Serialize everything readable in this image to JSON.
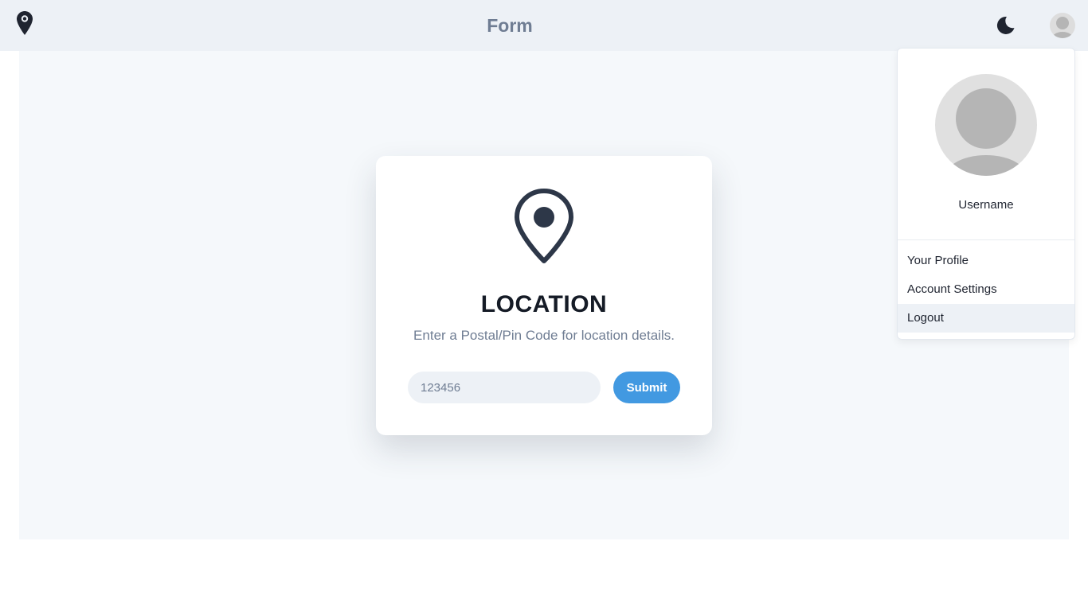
{
  "header": {
    "title": "Form",
    "logo_icon": "map-pin-icon",
    "theme_icon": "moon-icon",
    "avatar_icon": "user-avatar-icon"
  },
  "card": {
    "icon": "map-pin-icon",
    "title": "LOCATION",
    "subtitle": "Enter a Postal/Pin Code for location details.",
    "input_placeholder": "123456",
    "submit_label": "Submit"
  },
  "dropdown": {
    "username": "Username",
    "items": [
      {
        "label": "Your Profile"
      },
      {
        "label": "Account Settings"
      },
      {
        "label": "Logout",
        "highlighted": true
      }
    ]
  },
  "colors": {
    "header_bg": "#edf1f6",
    "main_bg": "#f5f8fb",
    "accent": "#4299e1",
    "icon_dark": "#1f2430",
    "card_icon": "#2d3748",
    "muted_text": "#6f7d93"
  }
}
